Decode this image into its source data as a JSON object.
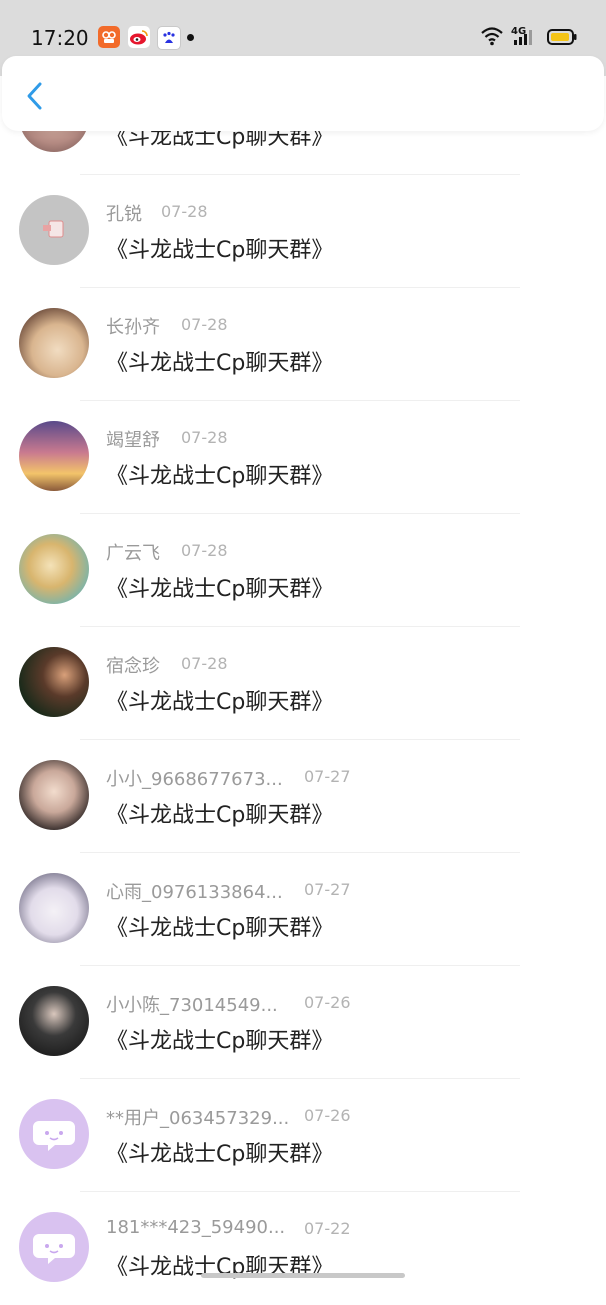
{
  "status_bar": {
    "time": "17:20",
    "network": "4G",
    "icons": [
      "app-camera-icon",
      "weibo-icon",
      "baidu-icon"
    ]
  },
  "colors": {
    "accent": "#2f9be8",
    "battery": "#f5c518",
    "avatar_default": "#d9c2f0"
  },
  "list": {
    "items": [
      {
        "name": "",
        "date": "",
        "message": "《斗龙战士Cp聊天群》",
        "avatar": "photo-avatar"
      },
      {
        "name": "孔锐",
        "date": "07-28",
        "message": "《斗龙战士Cp聊天群》",
        "avatar": "gray-photo-avatar"
      },
      {
        "name": "长孙齐",
        "date": "07-28",
        "message": "《斗龙战士Cp聊天群》",
        "avatar": "photo-avatar"
      },
      {
        "name": "竭望舒",
        "date": "07-28",
        "message": "《斗龙战士Cp聊天群》",
        "avatar": "photo-avatar"
      },
      {
        "name": "广云飞",
        "date": "07-28",
        "message": "《斗龙战士Cp聊天群》",
        "avatar": "photo-avatar"
      },
      {
        "name": "宿念珍",
        "date": "07-28",
        "message": "《斗龙战士Cp聊天群》",
        "avatar": "photo-avatar"
      },
      {
        "name": "小小_9668677673...",
        "date": "07-27",
        "message": "《斗龙战士Cp聊天群》",
        "avatar": "photo-avatar"
      },
      {
        "name": "心雨_0976133864...",
        "date": "07-27",
        "message": "《斗龙战士Cp聊天群》",
        "avatar": "photo-avatar"
      },
      {
        "name": "小小陈_73014549...",
        "date": "07-26",
        "message": "《斗龙战士Cp聊天群》",
        "avatar": "photo-avatar"
      },
      {
        "name": "**用户_063457329...",
        "date": "07-26",
        "message": "《斗龙战士Cp聊天群》",
        "avatar": "default-chat-avatar"
      },
      {
        "name": "181***423_59490...",
        "date": "07-22",
        "message": "《斗龙战士Cp聊天群》",
        "avatar": "default-chat-avatar"
      }
    ]
  }
}
